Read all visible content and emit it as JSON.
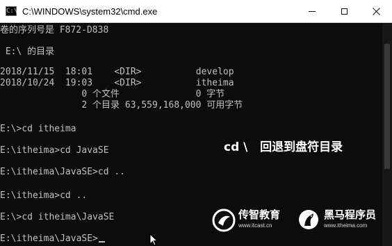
{
  "window": {
    "icon_glyph": "C:\\",
    "title": "C:\\WINDOWS\\system32\\cmd.exe"
  },
  "console": {
    "lines": [
      "卷的序列号是 F872-D838",
      "",
      " E:\\ 的目录",
      "",
      "2018/11/15  18:01    <DIR>          develop",
      "2018/10/24  19:03    <DIR>          itheima",
      "               0 个文件              0 字节",
      "               2 个目录 63,559,168,000 可用字节",
      "",
      "E:\\>cd itheima",
      "",
      "E:\\itheima>cd JavaSE",
      "",
      "E:\\itheima\\JavaSE>cd ..",
      "",
      "E:\\itheima>cd ..",
      "",
      "E:\\>cd itheima\\JavaSE",
      "",
      "E:\\itheima\\JavaSE>"
    ]
  },
  "annotation": "cd \\   回退到盘符目录",
  "watermarks": {
    "logo1_name": "传智教育",
    "logo1_url": "www.itcast.cn",
    "logo2_name": "黑马程序员",
    "logo2_url": "www.itheima.com"
  }
}
